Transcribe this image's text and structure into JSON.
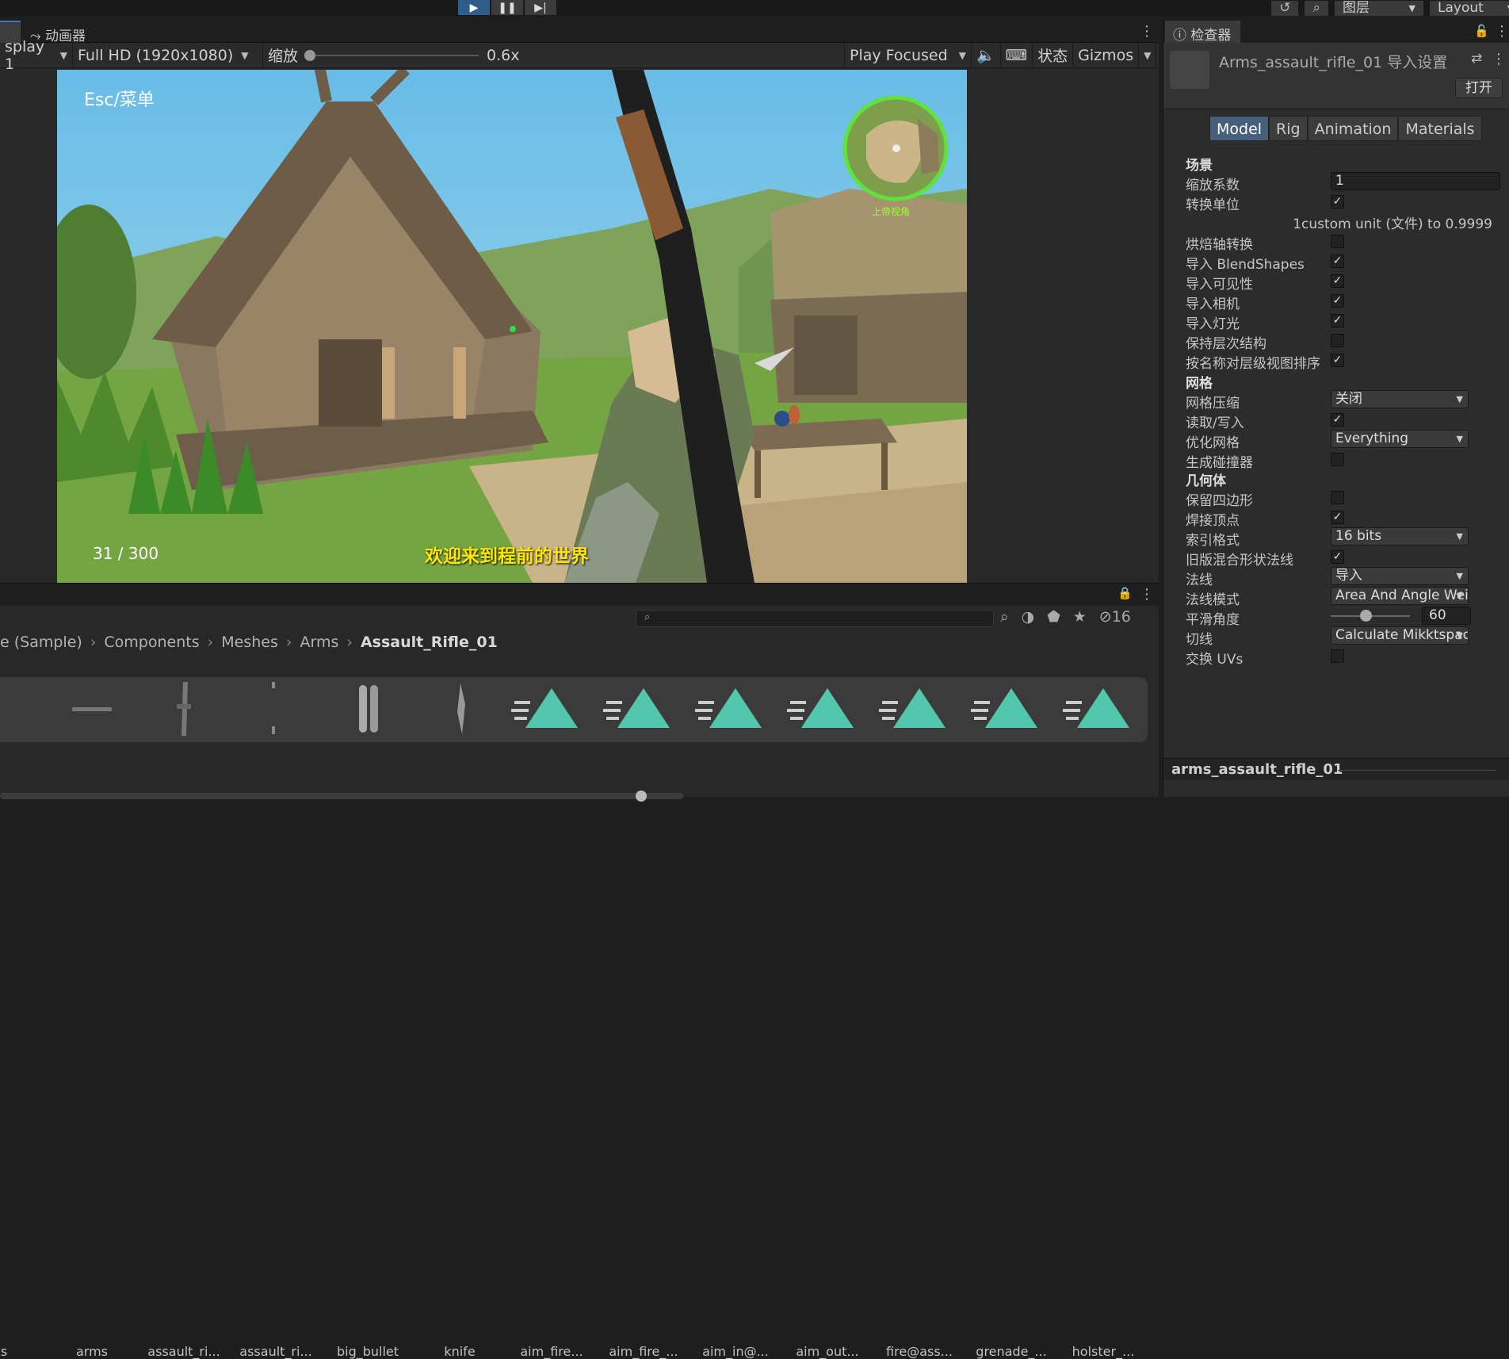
{
  "toolbar": {
    "play_icon": "play-icon",
    "pause_icon": "pause-icon",
    "step_icon": "step-icon",
    "history_icon": "history-icon",
    "search_icon": "search-icon",
    "layers_label": "图层",
    "layout_label": "Layout"
  },
  "game": {
    "animator_tab": "动画器",
    "display": "splay 1",
    "resolution": "Full HD (1920x1080)",
    "scale_label": "缩放",
    "scale_value": "0.6x",
    "play_mode": "Play Focused",
    "stats": "状态",
    "gizmos": "Gizmos",
    "hud_menu": "Esc/菜单",
    "hud_counter": "31 / 300",
    "hud_welcome": "欢迎来到程前的世界",
    "minimap_label": "上帝视角"
  },
  "project": {
    "hidden_count": "16",
    "breadcrumb": [
      "e (Sample)",
      "Components",
      "Meshes",
      "Arms"
    ],
    "breadcrumb_current": "Assault_Rifle_01",
    "assets": [
      "ns",
      "arms",
      "assault_ri...",
      "assault_ri...",
      "big_bullet",
      "knife",
      "aim_fire...",
      "aim_fire_...",
      "aim_in@...",
      "aim_out...",
      "fire@ass...",
      "grenade_...",
      "holster_..."
    ]
  },
  "inspector": {
    "tab": "检查器",
    "title": "Arms_assault_rifle_01 导入设置",
    "open": "打开",
    "model_tabs": [
      "Model",
      "Rig",
      "Animation",
      "Materials"
    ],
    "scene_header": "场景",
    "scale_factor_label": "缩放系数",
    "scale_factor": "1",
    "convert_units": "转换单位",
    "unit_note": "1custom unit (文件) to 0.9999",
    "bake_axis": "烘焙轴转换",
    "blendshapes": "导入 BlendShapes",
    "visibility": "导入可见性",
    "cameras": "导入相机",
    "lights": "导入灯光",
    "preserve_hierarchy": "保持层次结构",
    "sort_hierarchy": "按名称对层级视图排序",
    "meshes_header": "网格",
    "mesh_compression": "网格压缩",
    "mesh_compression_value": "关闭",
    "read_write": "读取/写入",
    "optimize_mesh": "优化网格",
    "optimize_mesh_value": "Everything",
    "gen_colliders": "生成碰撞器",
    "geometry_header": "几何体",
    "keep_quads": "保留四边形",
    "weld_vertices": "焊接顶点",
    "index_format": "索引格式",
    "index_format_value": "16 bits",
    "legacy_blend_normals": "旧版混合形状法线",
    "normals": "法线",
    "normals_value": "导入",
    "normals_mode": "法线模式",
    "normals_mode_value": "Area And Angle Weig",
    "smoothing_angle": "平滑角度",
    "smoothing_angle_value": "60",
    "tangents": "切线",
    "tangents_value": "Calculate Mikktspace",
    "swap_uvs": "交换 UVs",
    "footer": "arms_assault_rifle_01"
  }
}
